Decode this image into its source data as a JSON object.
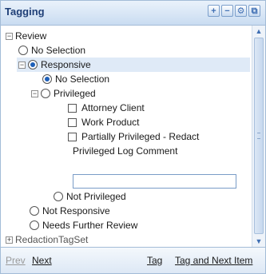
{
  "header": {
    "title": "Tagging",
    "buttons": {
      "add": "+",
      "remove": "−",
      "settings": "⚙",
      "popout": "⧉"
    }
  },
  "tree": {
    "review": "Review",
    "no_selection_1": "No Selection",
    "responsive": "Responsive",
    "no_selection_2": "No Selection",
    "privileged": "Privileged",
    "attorney_client": "Attorney Client",
    "work_product": "Work Product",
    "partially_privileged": "Partially Privileged - Redact",
    "privileged_log_comment": "Privileged Log Comment",
    "privileged_log_comment_value": "",
    "not_privileged": "Not Privileged",
    "not_responsive": "Not Responsive",
    "needs_further_review": "Needs Further Review",
    "redaction_tagset": "RedactionTagSet"
  },
  "footer": {
    "prev": "Prev",
    "next": "Next",
    "tag": "Tag",
    "tag_and_next": "Tag and Next Item"
  },
  "colors": {
    "accent": "#1f3f77",
    "border": "#a3bcd7",
    "selection": "#dfeaf7"
  }
}
